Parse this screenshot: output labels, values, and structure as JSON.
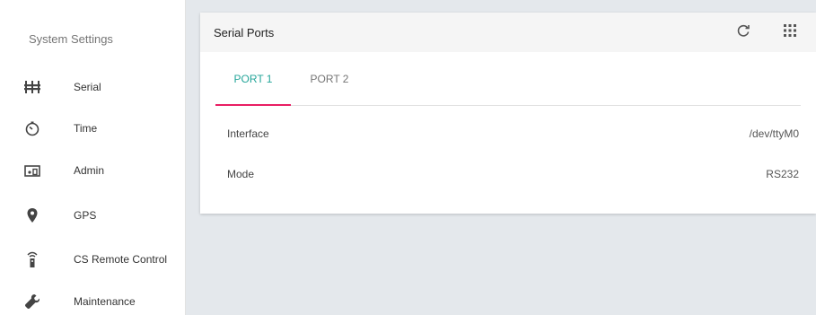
{
  "sidebar": {
    "title": "System Settings",
    "items": [
      {
        "label": "Serial",
        "icon": "serial-ports-icon"
      },
      {
        "label": "Time",
        "icon": "timer-icon"
      },
      {
        "label": "Admin",
        "icon": "admin-icon"
      },
      {
        "label": "GPS",
        "icon": "location-pin-icon"
      },
      {
        "label": "CS Remote Control",
        "icon": "remote-control-icon"
      },
      {
        "label": "Maintenance",
        "icon": "wrench-icon"
      }
    ]
  },
  "panel": {
    "title": "Serial Ports",
    "actions": [
      "refresh-icon",
      "apps-grid-icon"
    ],
    "tabs": [
      {
        "label": "PORT 1",
        "active": true
      },
      {
        "label": "PORT 2",
        "active": false
      }
    ],
    "fields": [
      {
        "label": "Interface",
        "value": "/dev/ttyM0"
      },
      {
        "label": "Mode",
        "value": "RS232"
      }
    ]
  },
  "colors": {
    "accent_tab_text": "#26a69a",
    "tab_indicator": "#e91e63",
    "background": "#e4e8ec"
  }
}
